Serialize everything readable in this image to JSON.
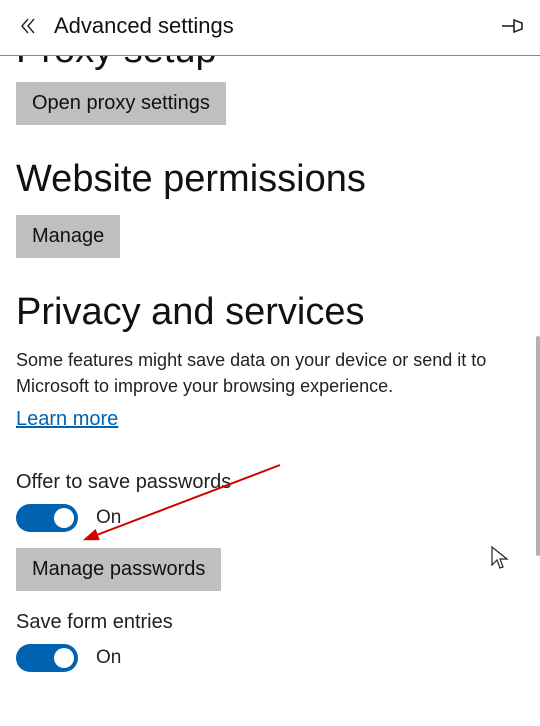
{
  "header": {
    "title": "Advanced settings"
  },
  "proxy": {
    "heading": "Proxy setup",
    "button": "Open proxy settings"
  },
  "website_permissions": {
    "heading": "Website permissions",
    "button": "Manage"
  },
  "privacy": {
    "heading": "Privacy and services",
    "description": "Some features might save data on your device or send it to Microsoft to improve your browsing experience.",
    "learn_more": "Learn more",
    "save_passwords": {
      "label": "Offer to save passwords",
      "state": "On",
      "manage_btn": "Manage passwords"
    },
    "save_form": {
      "label": "Save form entries",
      "state": "On"
    }
  }
}
